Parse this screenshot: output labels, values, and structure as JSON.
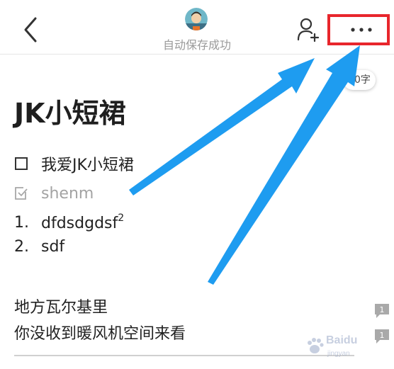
{
  "header": {
    "save_status": "自动保存成功",
    "back_icon": "chevron-left-icon",
    "avatar_icon": "user-avatar",
    "collab_icon": "add-person-icon",
    "more_icon": "more-dots-icon",
    "highlight_color": "#e8262c"
  },
  "word_count": "30字",
  "note": {
    "title": "JK小短裙",
    "checklist": [
      {
        "text": "我爱JK小短裙",
        "checked": false
      },
      {
        "text": "shenm",
        "checked": true
      }
    ],
    "ordered_list": [
      {
        "num": "1.",
        "text": "dfdsdgdsf",
        "sup": "2"
      },
      {
        "num": "2.",
        "text": "sdf",
        "sup": ""
      }
    ],
    "paragraphs": [
      {
        "text": "地方瓦尔基里",
        "comment_count": "1"
      },
      {
        "text": "你没收到暖风机空间来看",
        "comment_count": "1"
      }
    ]
  },
  "annotation": {
    "arrow_color": "#1e9cf0"
  },
  "watermark": {
    "brand": "Baidu",
    "sub": "jingyan"
  }
}
